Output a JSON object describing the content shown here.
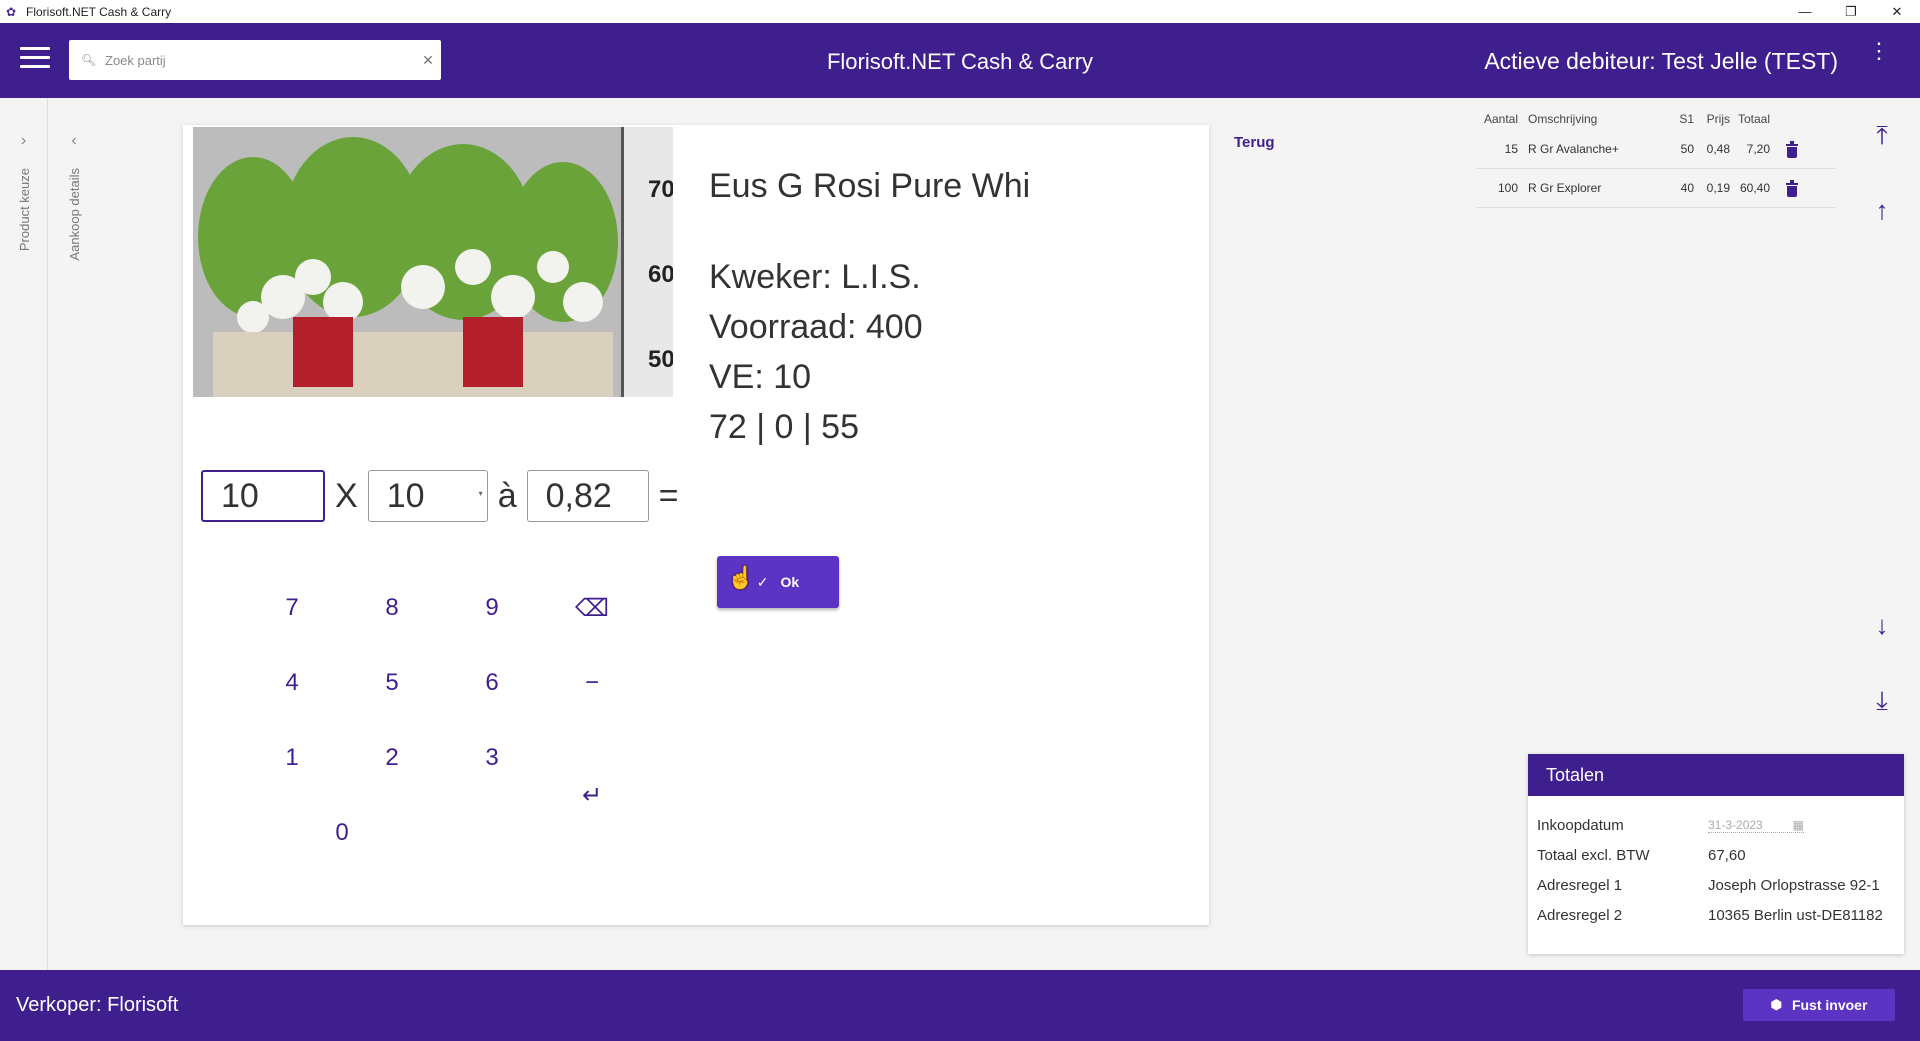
{
  "window": {
    "title": "Florisoft.NET Cash & Carry",
    "minimize": "—",
    "restore": "❐",
    "close": "✕"
  },
  "header": {
    "search_placeholder": "Zoek partij",
    "app_title": "Florisoft.NET Cash & Carry",
    "debiteur": "Actieve debiteur: Test Jelle (TEST)"
  },
  "rails": {
    "product_keuze": "Product keuze",
    "aankoop_details": "Aankoop details"
  },
  "product": {
    "name": "Eus G Rosi Pure Whi",
    "kweker": "Kweker: L.I.S.",
    "voorraad": "Voorraad: 400",
    "ve": "VE: 10",
    "codes": "72 | 0 | 55",
    "ruler_labels": [
      "70",
      "60",
      "50"
    ]
  },
  "calc": {
    "qty": "10",
    "x": "X",
    "per": "10",
    "a": "à",
    "price": "0,82",
    "eq": "="
  },
  "ok_label": "Ok",
  "keypad": {
    "k7": "7",
    "k8": "8",
    "k9": "9",
    "backspace": "⌫",
    "k4": "4",
    "k5": "5",
    "k6": "6",
    "minus": "−",
    "k1": "1",
    "k2": "2",
    "k3": "3",
    "enter": "↵",
    "k0": "0"
  },
  "terug": "Terug",
  "order": {
    "headers": {
      "aantal": "Aantal",
      "omschrijving": "Omschrijving",
      "s1": "S1",
      "prijs": "Prijs",
      "totaal": "Totaal"
    },
    "rows": [
      {
        "aantal": "15",
        "omschrijving": "R Gr Avalanche+",
        "s1": "50",
        "prijs": "0,48",
        "totaal": "7,20"
      },
      {
        "aantal": "100",
        "omschrijving": "R Gr Explorer",
        "s1": "40",
        "prijs": "0,19",
        "totaal": "60,40"
      }
    ]
  },
  "nav_icons": {
    "top": "⤒",
    "up": "↑",
    "down": "↓",
    "bottom": "⤓"
  },
  "totals": {
    "title": "Totalen",
    "inkoopdatum_label": "Inkoopdatum",
    "inkoopdatum_value": "31-3-2023",
    "excl_label": "Totaal excl. BTW",
    "excl_value": "67,60",
    "adres1_label": "Adresregel 1",
    "adres1_value": "Joseph Orlopstrasse 92-1",
    "adres2_label": "Adresregel 2",
    "adres2_value": "10365 Berlin ust-DE81182"
  },
  "footer": {
    "verkoper": "Verkoper: Florisoft",
    "fust_label": "Fust invoer"
  },
  "colors": {
    "primary": "#3f1f8e",
    "button": "#5b34c4"
  }
}
